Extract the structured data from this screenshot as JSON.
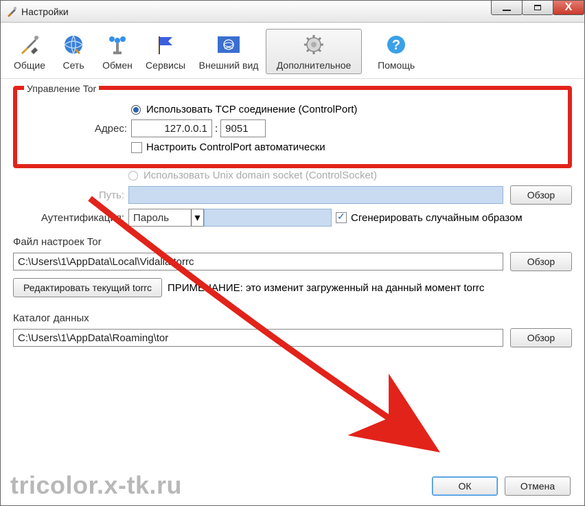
{
  "window": {
    "title": "Настройки"
  },
  "toolbar": {
    "items": [
      {
        "label": "Общие"
      },
      {
        "label": "Сеть"
      },
      {
        "label": "Обмен"
      },
      {
        "label": "Сервисы"
      },
      {
        "label": "Внешний вид"
      },
      {
        "label": "Дополнительное"
      },
      {
        "label": "Помощь"
      }
    ]
  },
  "tor": {
    "group_title": "Управление Tor",
    "use_tcp_label": "Использовать TCP соединение (ControlPort)",
    "address_label": "Адрес:",
    "address_ip": "127.0.0.1",
    "address_sep": ":",
    "address_port": "9051",
    "auto_controlport_label": "Настроить ControlPort автоматически",
    "use_unix_label": "Использовать Unix domain socket (ControlSocket)",
    "path_label": "Путь:",
    "path_value": "",
    "browse1": "Обзор",
    "auth_label": "Аутентификация:",
    "auth_select_value": "Пароль",
    "auth_pass_value": "",
    "auth_random_label": "Сгенерировать случайным образом"
  },
  "torrc": {
    "section_label": "Файл настроек Tor",
    "path": "C:\\Users\\1\\AppData\\Local\\Vidalia\\torrc",
    "browse": "Обзор",
    "edit_btn": "Редактировать текущий torrc",
    "note": "ПРИМЕЧАНИЕ: это изменит загруженный на данный момент torrc"
  },
  "datadir": {
    "section_label": "Каталог данных",
    "path": "C:\\Users\\1\\AppData\\Roaming\\tor",
    "browse": "Обзор"
  },
  "buttons": {
    "ok": "ОК",
    "cancel": "Отмена"
  },
  "watermark": "tricolor.x-tk.ru"
}
